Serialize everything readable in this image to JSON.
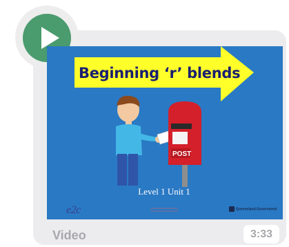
{
  "video": {
    "title": "Beginning ‘r’ blends",
    "subtitle": "Level 1 Unit 1",
    "logo_left": "e2c",
    "logo_right": "Queensland Government",
    "mailbox_label": "POST",
    "label": "Video",
    "duration": "3:33"
  },
  "icons": {
    "play": "play-icon"
  },
  "colors": {
    "play_button": "#4a9b6e",
    "thumbnail_bg": "#2a79c4",
    "arrow": "#ffff2a",
    "title_text": "#1a1f70"
  }
}
